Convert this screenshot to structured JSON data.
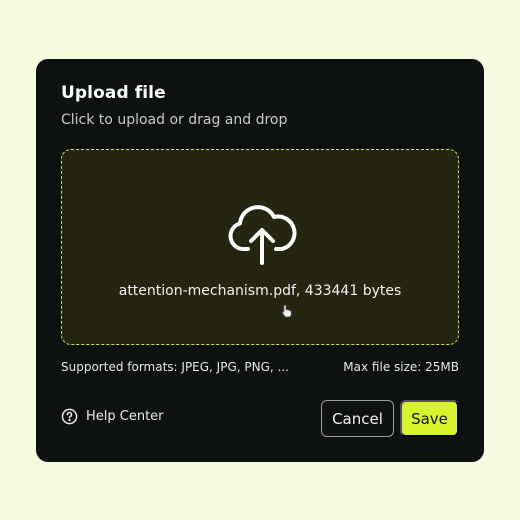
{
  "dialog": {
    "title": "Upload file",
    "subtitle": "Click to upload or drag and drop"
  },
  "dropzone": {
    "file_info": "attention-mechanism.pdf, 433441 bytes",
    "upload_icon": "cloud-upload-icon",
    "cursor_icon": "hand-pointer-icon"
  },
  "constraints": {
    "formats": "Supported formats: JPEG, JPG, PNG, ...",
    "max_size": "Max file size: 25MB"
  },
  "footer": {
    "help_label": "Help Center",
    "help_icon": "question-circle-icon",
    "cancel_label": "Cancel",
    "save_label": "Save"
  },
  "colors": {
    "background": "#f7fbdf",
    "card": "#0f1111",
    "dropzone_fill": "#242611",
    "dropzone_border": "#cfe35a",
    "accent": "#d6f52c"
  }
}
